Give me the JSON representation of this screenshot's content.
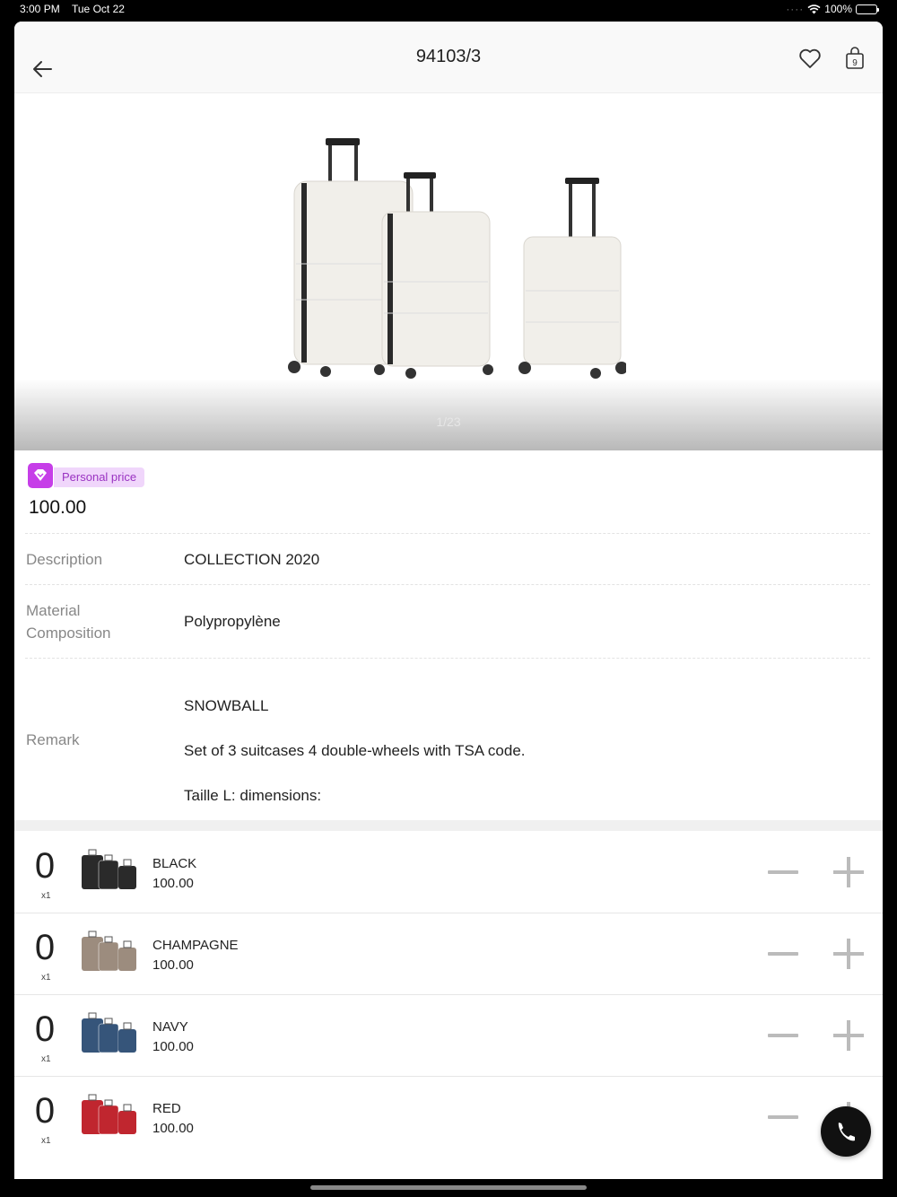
{
  "status": {
    "time": "3:00 PM",
    "date": "Tue Oct 22",
    "battery": "100%"
  },
  "header": {
    "title": "94103/3",
    "back_icon": "arrow-left-icon",
    "favorite_icon": "heart-icon",
    "cart_icon": "bag-icon",
    "cart_count": "9"
  },
  "gallery": {
    "counter": "1/23"
  },
  "pricing": {
    "badge": "Personal price",
    "price": "100.00",
    "badge_color": "#c63ee8"
  },
  "details": {
    "description_label": "Description",
    "description_value": "COLLECTION 2020",
    "material_label_1": "Material",
    "material_label_2": "Composition",
    "material_value": "Polypropylène",
    "remark_label": "Remark",
    "remark_line1": "SNOWBALL",
    "remark_line2": "Set of 3 suitcases 4 double-wheels with TSA code.",
    "remark_line3": "Taille L: dimensions:"
  },
  "variants": [
    {
      "qty": "0",
      "unit": "x1",
      "name": "BLACK",
      "price": "100.00",
      "color": "#2a2a2a"
    },
    {
      "qty": "0",
      "unit": "x1",
      "name": "CHAMPAGNE",
      "price": "100.00",
      "color": "#9c8c7e"
    },
    {
      "qty": "0",
      "unit": "x1",
      "name": "NAVY",
      "price": "100.00",
      "color": "#36557a"
    },
    {
      "qty": "0",
      "unit": "x1",
      "name": "RED",
      "price": "100.00",
      "color": "#c0262f"
    }
  ]
}
